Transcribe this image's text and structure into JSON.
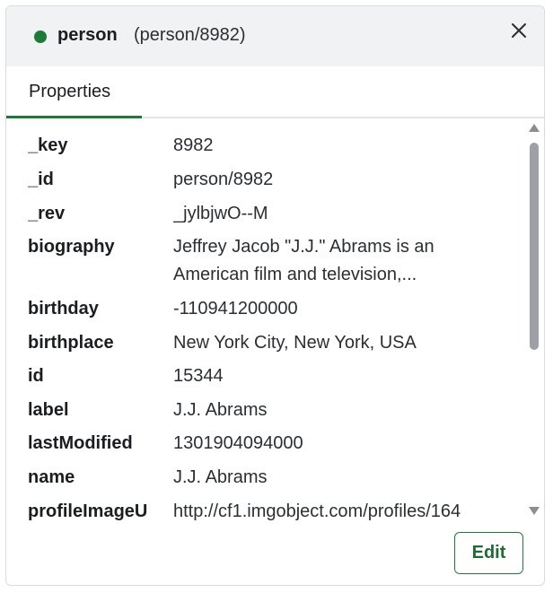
{
  "header": {
    "status_color": "#1e7a3a",
    "node_type": "person",
    "node_id": "(person/8982)",
    "close_icon": "close-icon"
  },
  "tabs": [
    {
      "label": "Properties",
      "active": true
    }
  ],
  "properties": [
    {
      "key": "_key",
      "value": "8982"
    },
    {
      "key": "_id",
      "value": "person/8982"
    },
    {
      "key": "_rev",
      "value": "_jylbjwO--M"
    },
    {
      "key": "biography",
      "value": "Jeffrey Jacob \"J.J.\" Abrams is an American film and television,..."
    },
    {
      "key": "birthday",
      "value": "-110941200000"
    },
    {
      "key": "birthplace",
      "value": "New York City, New York, USA"
    },
    {
      "key": "id",
      "value": "15344"
    },
    {
      "key": "label",
      "value": "J.J. Abrams"
    },
    {
      "key": "lastModified",
      "value": "1301904094000"
    },
    {
      "key": "name",
      "value": "J.J. Abrams"
    },
    {
      "key": "profileImageU",
      "value": "http://cf1.imgobject.com/profiles/164"
    }
  ],
  "footer": {
    "edit_label": "Edit"
  },
  "colors": {
    "accent": "#1e7a3a",
    "header_bg": "#f1f2f3"
  }
}
